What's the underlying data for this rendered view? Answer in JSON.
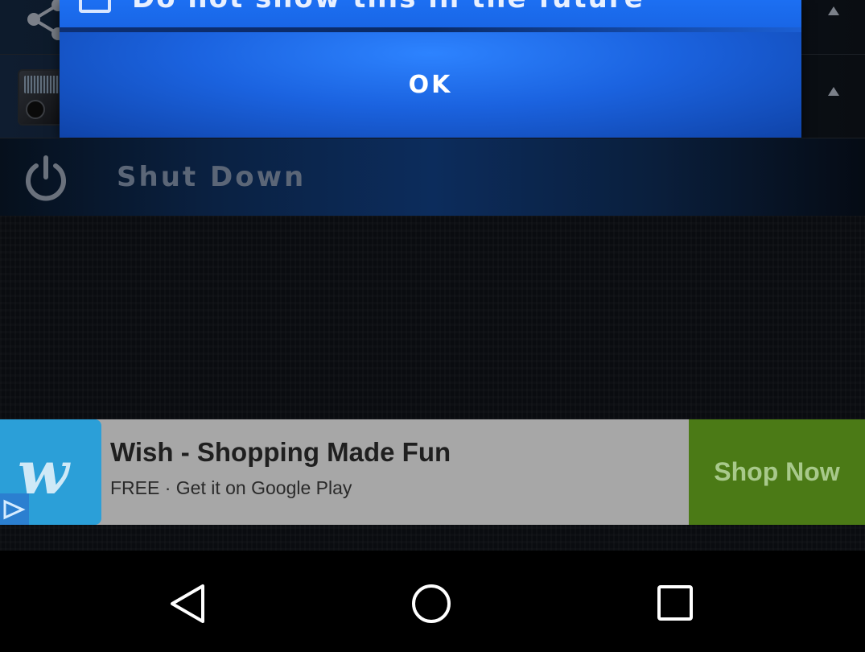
{
  "dialog": {
    "checkbox_label": "Do not show this in the future",
    "ok_label": "OK"
  },
  "menu": {
    "shutdown_label": "Shut Down"
  },
  "ad": {
    "logo_text": "w",
    "title": "Wish - Shopping Made Fun",
    "subtitle": "FREE · Get it on Google Play",
    "cta_label": "Shop Now"
  },
  "icons": {
    "share": "share-icon",
    "power": "power-icon",
    "back": "back-icon",
    "home": "home-icon",
    "recent": "recent-apps-icon"
  },
  "colors": {
    "dialog_blue": "#1c6ff2",
    "ad_cta_green": "#4b7a16",
    "wish_blue": "#2b9fd8"
  }
}
